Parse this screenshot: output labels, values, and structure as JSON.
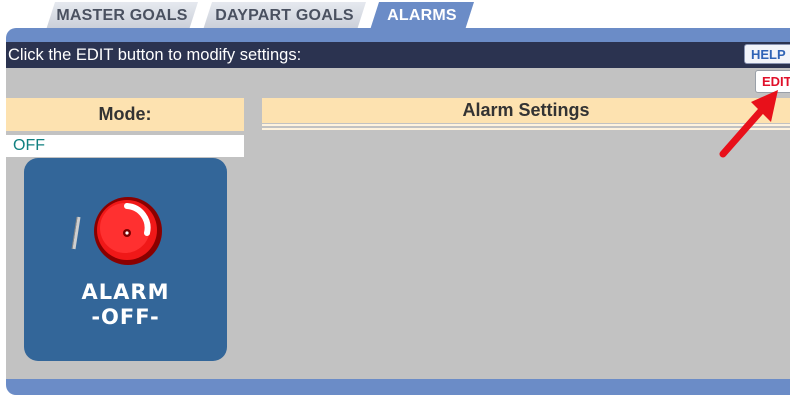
{
  "tabs": [
    {
      "label": "MASTER GOALS",
      "active": false
    },
    {
      "label": "DAYPART GOALS",
      "active": false
    },
    {
      "label": "ALARMS",
      "active": true
    }
  ],
  "instruction": "Click the EDIT button to modify settings:",
  "buttons": {
    "help_label": "HELP",
    "edit_label": "EDIT"
  },
  "mode": {
    "header": "Mode:",
    "value": "OFF"
  },
  "alarm_settings": {
    "header": "Alarm Settings"
  },
  "alarm_tile": {
    "icon": "alarm-bell-icon",
    "line1": "ALARM",
    "line2": "-OFF-"
  },
  "colors": {
    "accent_blue": "#6b8cc7",
    "instruction_bar": "#2b3350",
    "panel_gray": "#c2c2c2",
    "header_peach": "#fde2b0",
    "tile_blue": "#336699",
    "edit_red": "#e0102a",
    "mode_teal": "#108080"
  }
}
